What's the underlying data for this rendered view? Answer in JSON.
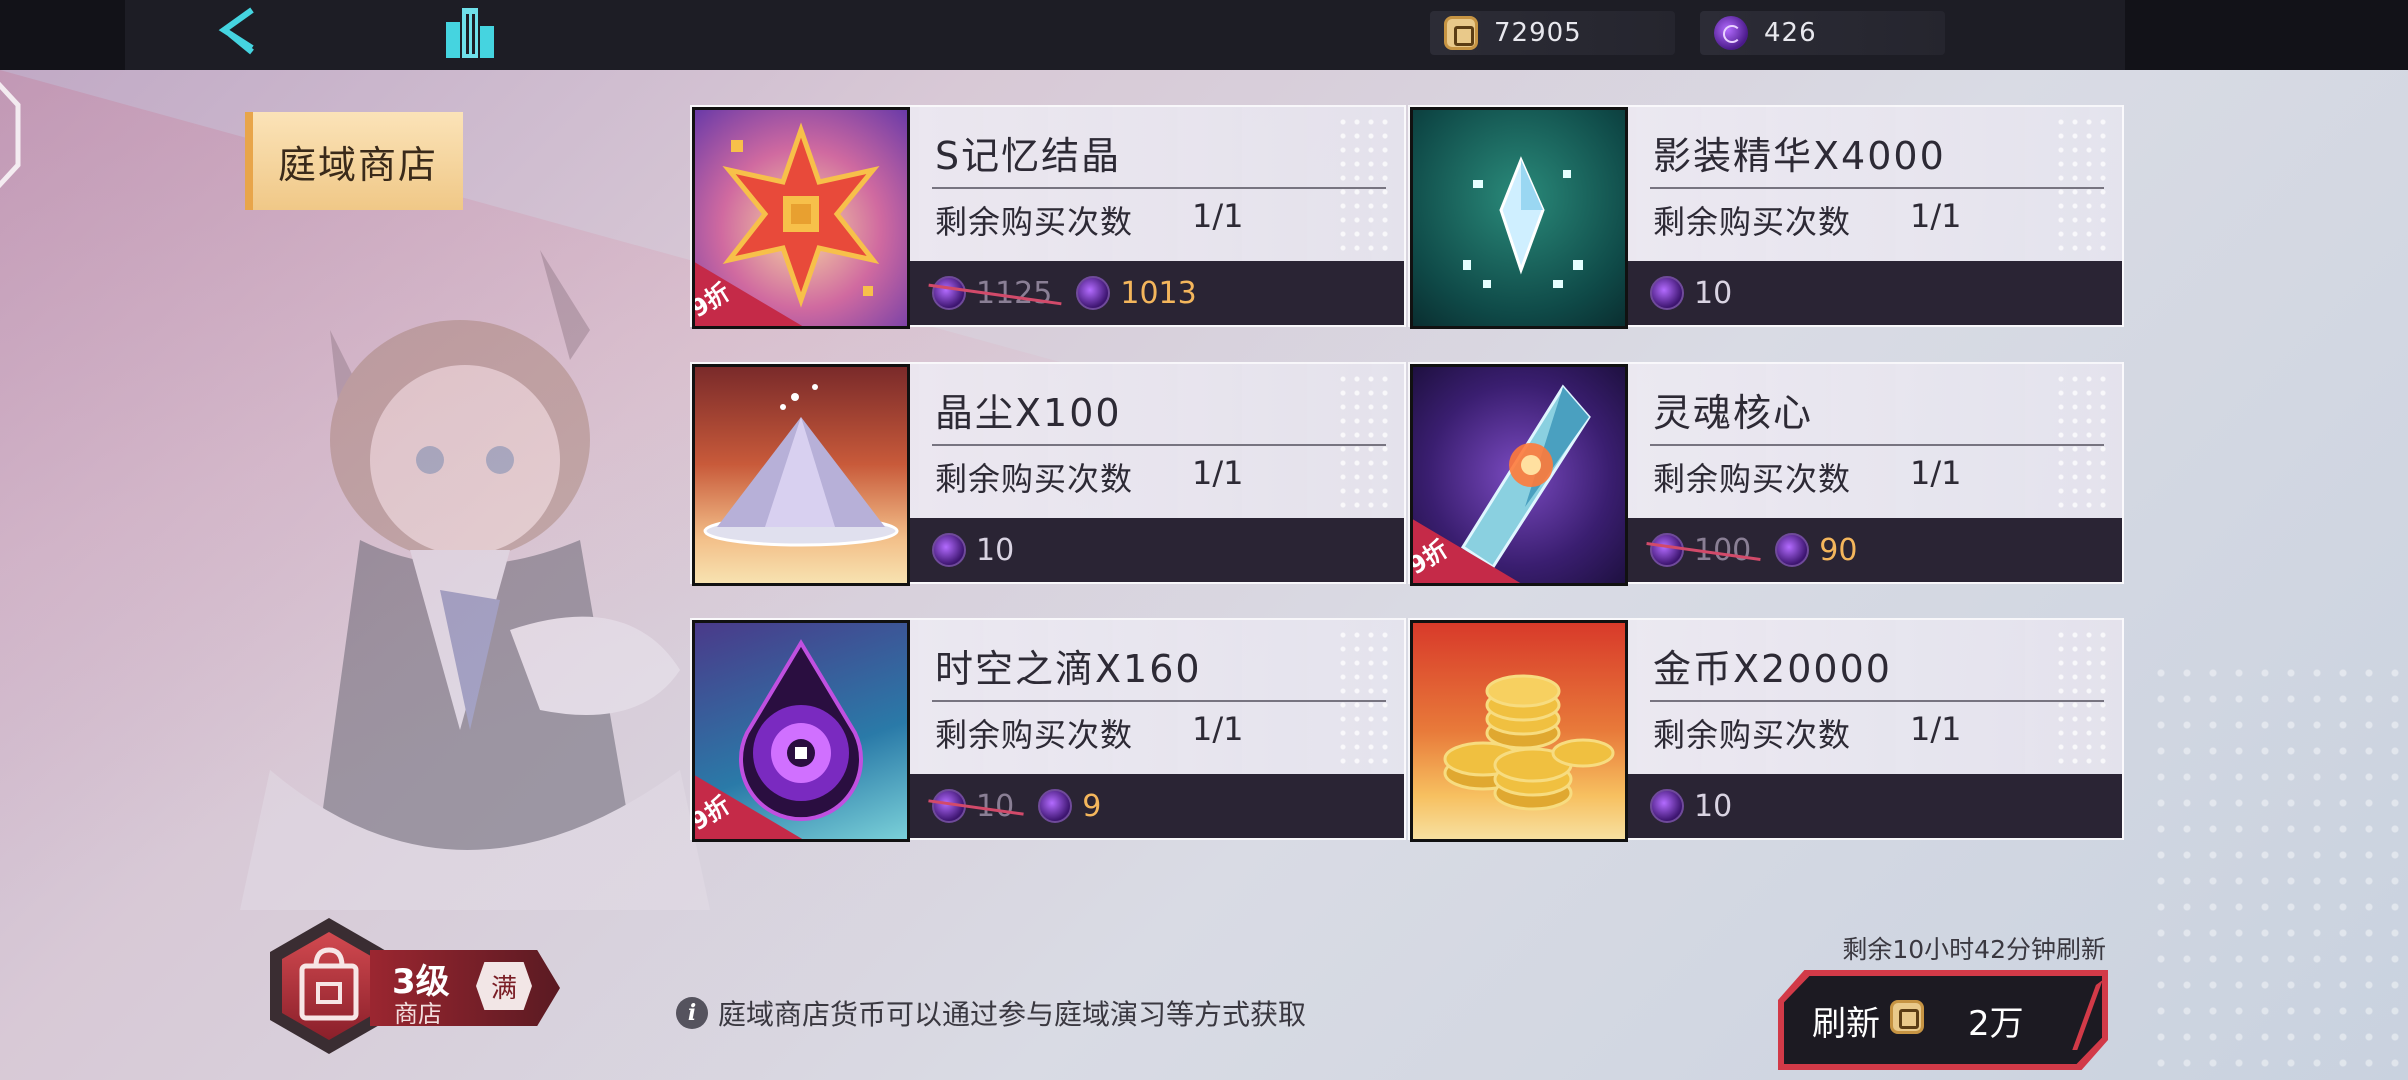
{
  "topbar": {
    "currency_a": "72905",
    "currency_b": "426"
  },
  "shop": {
    "title": "庭域商店"
  },
  "items": [
    {
      "name": "S记忆结晶",
      "limit_label": "剩余购买次数",
      "limit": "1/1",
      "old_price": "1125",
      "price": "1013",
      "discount": "9折",
      "thumb": "s-memory-crystal"
    },
    {
      "name": "影装精华X4000",
      "limit_label": "剩余购买次数",
      "limit": "1/1",
      "price": "10",
      "thumb": "shadow-essence"
    },
    {
      "name": "晶尘X100",
      "limit_label": "剩余购买次数",
      "limit": "1/1",
      "price": "10",
      "thumb": "crystal-dust"
    },
    {
      "name": "灵魂核心",
      "limit_label": "剩余购买次数",
      "limit": "1/1",
      "old_price": "100",
      "price": "90",
      "discount": "9折",
      "thumb": "soul-core"
    },
    {
      "name": "时空之滴X160",
      "limit_label": "剩余购买次数",
      "limit": "1/1",
      "old_price": "10",
      "price": "9",
      "discount": "9折",
      "thumb": "spacetime-drop"
    },
    {
      "name": "金币X20000",
      "limit_label": "剩余购买次数",
      "limit": "1/1",
      "price": "10",
      "thumb": "gold-coins"
    }
  ],
  "level_badge": {
    "level": "3级",
    "sub": "商店",
    "full": "满"
  },
  "info_text": "庭域商店货币可以通过参与庭域演习等方式获取",
  "refresh": {
    "time_text": "剩余10小时42分钟刷新",
    "label": "刷新",
    "cost": "2万"
  },
  "colors": {
    "accent_red": "#d23a48",
    "discount_tag": "#c52a48",
    "price_highlight": "#f4b65c",
    "title_plate": "#f0c887"
  }
}
